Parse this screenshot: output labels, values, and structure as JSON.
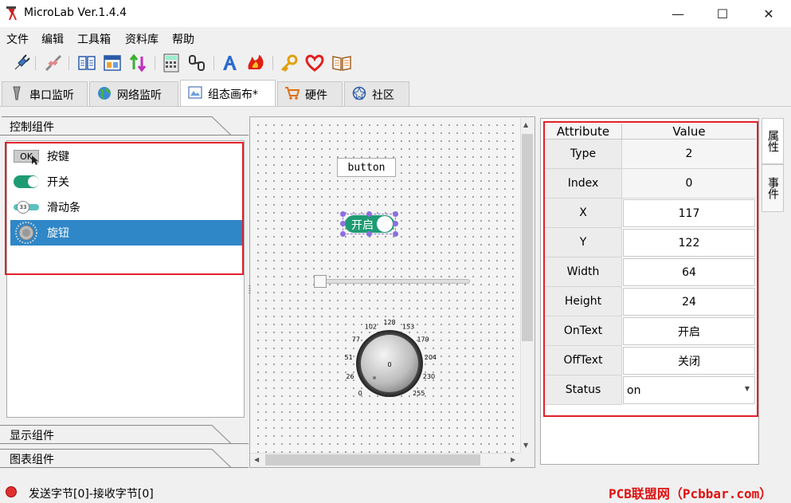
{
  "window": {
    "title": "MicroLab Ver.1.4.4",
    "minimize_icon": "minimize-icon",
    "maximize_icon": "maximize-icon",
    "close_icon": "close-icon"
  },
  "menu": [
    "文件",
    "编辑",
    "工具箱",
    "资料库",
    "帮助"
  ],
  "toolbar": {
    "icons": [
      "connect-icon",
      "disconnect-icon",
      "split-view-icon",
      "layout-icon",
      "sort-icon",
      "calculator-icon",
      "link-icon",
      "font-icon",
      "flame-icon",
      "key-icon",
      "heart-icon",
      "book-icon"
    ]
  },
  "tabs": [
    {
      "label": "串口监听",
      "icon": "probe-icon"
    },
    {
      "label": "网络监听",
      "icon": "globe-icon"
    },
    {
      "label": "组态画布*",
      "icon": "canvas-icon"
    },
    {
      "label": "硬件",
      "icon": "cart-icon"
    },
    {
      "label": "社区",
      "icon": "community-icon"
    }
  ],
  "left_panel": {
    "control_header": "控制组件",
    "components": [
      {
        "label": "按键",
        "icon_text": "OK"
      },
      {
        "label": "开关"
      },
      {
        "label": "滑动条",
        "icon_text": "33"
      },
      {
        "label": "旋钮"
      }
    ],
    "display_header": "显示组件",
    "chart_header": "图表组件"
  },
  "canvas": {
    "button_label": "button",
    "switch_label": "开启",
    "knob_ticks": [
      "0",
      "26",
      "51",
      "77",
      "102",
      "128",
      "153",
      "179",
      "204",
      "230",
      "255"
    ],
    "knob_center": "0"
  },
  "properties": {
    "header_attribute": "Attribute",
    "header_value": "Value",
    "rows": [
      {
        "key": "Type",
        "value": "2"
      },
      {
        "key": "Index",
        "value": "0"
      },
      {
        "key": "X",
        "value": "117"
      },
      {
        "key": "Y",
        "value": "122"
      },
      {
        "key": "Width",
        "value": "64"
      },
      {
        "key": "Height",
        "value": "24"
      },
      {
        "key": "OnText",
        "value": "开启"
      },
      {
        "key": "OffText",
        "value": "关闭"
      },
      {
        "key": "Status",
        "value": "on"
      }
    ]
  },
  "side_tabs": [
    "属性",
    "事件"
  ],
  "status": {
    "text": "发送字节[0]-接收字节[0]",
    "watermark": "PCB联盟网（Pcbbar.com）"
  },
  "colors": {
    "accent": "#2f87c7",
    "highlight_border": "#e0202a",
    "switch_on": "#1f9b74"
  }
}
